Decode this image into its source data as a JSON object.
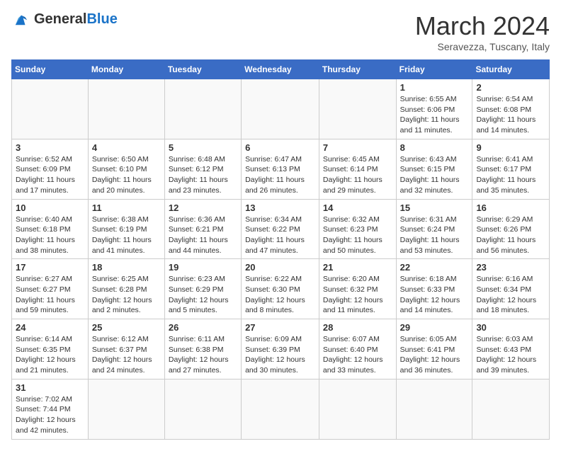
{
  "header": {
    "logo_general": "General",
    "logo_blue": "Blue",
    "month_title": "March 2024",
    "subtitle": "Seravezza, Tuscany, Italy"
  },
  "weekdays": [
    "Sunday",
    "Monday",
    "Tuesday",
    "Wednesday",
    "Thursday",
    "Friday",
    "Saturday"
  ],
  "weeks": [
    [
      {
        "day": "",
        "info": ""
      },
      {
        "day": "",
        "info": ""
      },
      {
        "day": "",
        "info": ""
      },
      {
        "day": "",
        "info": ""
      },
      {
        "day": "",
        "info": ""
      },
      {
        "day": "1",
        "info": "Sunrise: 6:55 AM\nSunset: 6:06 PM\nDaylight: 11 hours and 11 minutes."
      },
      {
        "day": "2",
        "info": "Sunrise: 6:54 AM\nSunset: 6:08 PM\nDaylight: 11 hours and 14 minutes."
      }
    ],
    [
      {
        "day": "3",
        "info": "Sunrise: 6:52 AM\nSunset: 6:09 PM\nDaylight: 11 hours and 17 minutes."
      },
      {
        "day": "4",
        "info": "Sunrise: 6:50 AM\nSunset: 6:10 PM\nDaylight: 11 hours and 20 minutes."
      },
      {
        "day": "5",
        "info": "Sunrise: 6:48 AM\nSunset: 6:12 PM\nDaylight: 11 hours and 23 minutes."
      },
      {
        "day": "6",
        "info": "Sunrise: 6:47 AM\nSunset: 6:13 PM\nDaylight: 11 hours and 26 minutes."
      },
      {
        "day": "7",
        "info": "Sunrise: 6:45 AM\nSunset: 6:14 PM\nDaylight: 11 hours and 29 minutes."
      },
      {
        "day": "8",
        "info": "Sunrise: 6:43 AM\nSunset: 6:15 PM\nDaylight: 11 hours and 32 minutes."
      },
      {
        "day": "9",
        "info": "Sunrise: 6:41 AM\nSunset: 6:17 PM\nDaylight: 11 hours and 35 minutes."
      }
    ],
    [
      {
        "day": "10",
        "info": "Sunrise: 6:40 AM\nSunset: 6:18 PM\nDaylight: 11 hours and 38 minutes."
      },
      {
        "day": "11",
        "info": "Sunrise: 6:38 AM\nSunset: 6:19 PM\nDaylight: 11 hours and 41 minutes."
      },
      {
        "day": "12",
        "info": "Sunrise: 6:36 AM\nSunset: 6:21 PM\nDaylight: 11 hours and 44 minutes."
      },
      {
        "day": "13",
        "info": "Sunrise: 6:34 AM\nSunset: 6:22 PM\nDaylight: 11 hours and 47 minutes."
      },
      {
        "day": "14",
        "info": "Sunrise: 6:32 AM\nSunset: 6:23 PM\nDaylight: 11 hours and 50 minutes."
      },
      {
        "day": "15",
        "info": "Sunrise: 6:31 AM\nSunset: 6:24 PM\nDaylight: 11 hours and 53 minutes."
      },
      {
        "day": "16",
        "info": "Sunrise: 6:29 AM\nSunset: 6:26 PM\nDaylight: 11 hours and 56 minutes."
      }
    ],
    [
      {
        "day": "17",
        "info": "Sunrise: 6:27 AM\nSunset: 6:27 PM\nDaylight: 11 hours and 59 minutes."
      },
      {
        "day": "18",
        "info": "Sunrise: 6:25 AM\nSunset: 6:28 PM\nDaylight: 12 hours and 2 minutes."
      },
      {
        "day": "19",
        "info": "Sunrise: 6:23 AM\nSunset: 6:29 PM\nDaylight: 12 hours and 5 minutes."
      },
      {
        "day": "20",
        "info": "Sunrise: 6:22 AM\nSunset: 6:30 PM\nDaylight: 12 hours and 8 minutes."
      },
      {
        "day": "21",
        "info": "Sunrise: 6:20 AM\nSunset: 6:32 PM\nDaylight: 12 hours and 11 minutes."
      },
      {
        "day": "22",
        "info": "Sunrise: 6:18 AM\nSunset: 6:33 PM\nDaylight: 12 hours and 14 minutes."
      },
      {
        "day": "23",
        "info": "Sunrise: 6:16 AM\nSunset: 6:34 PM\nDaylight: 12 hours and 18 minutes."
      }
    ],
    [
      {
        "day": "24",
        "info": "Sunrise: 6:14 AM\nSunset: 6:35 PM\nDaylight: 12 hours and 21 minutes."
      },
      {
        "day": "25",
        "info": "Sunrise: 6:12 AM\nSunset: 6:37 PM\nDaylight: 12 hours and 24 minutes."
      },
      {
        "day": "26",
        "info": "Sunrise: 6:11 AM\nSunset: 6:38 PM\nDaylight: 12 hours and 27 minutes."
      },
      {
        "day": "27",
        "info": "Sunrise: 6:09 AM\nSunset: 6:39 PM\nDaylight: 12 hours and 30 minutes."
      },
      {
        "day": "28",
        "info": "Sunrise: 6:07 AM\nSunset: 6:40 PM\nDaylight: 12 hours and 33 minutes."
      },
      {
        "day": "29",
        "info": "Sunrise: 6:05 AM\nSunset: 6:41 PM\nDaylight: 12 hours and 36 minutes."
      },
      {
        "day": "30",
        "info": "Sunrise: 6:03 AM\nSunset: 6:43 PM\nDaylight: 12 hours and 39 minutes."
      }
    ],
    [
      {
        "day": "31",
        "info": "Sunrise: 7:02 AM\nSunset: 7:44 PM\nDaylight: 12 hours and 42 minutes."
      },
      {
        "day": "",
        "info": ""
      },
      {
        "day": "",
        "info": ""
      },
      {
        "day": "",
        "info": ""
      },
      {
        "day": "",
        "info": ""
      },
      {
        "day": "",
        "info": ""
      },
      {
        "day": "",
        "info": ""
      }
    ]
  ]
}
